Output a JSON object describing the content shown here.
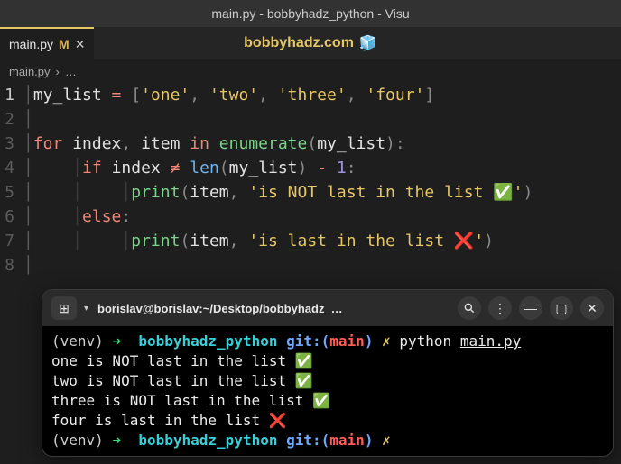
{
  "titlebar": "main.py - bobbyhadz_python - Visu",
  "tab": {
    "filename": "main.py",
    "modified_indicator": "M",
    "close_glyph": "✕"
  },
  "watermark": {
    "text": "bobbyhadz.com",
    "icon": "🧊"
  },
  "breadcrumb": {
    "file": "main.py",
    "separator": "›",
    "more": "…"
  },
  "code": {
    "lines": [
      {
        "n": "1",
        "indents": 0,
        "tokens": [
          [
            "var",
            "my_list"
          ],
          [
            "var",
            " "
          ],
          [
            "op",
            "="
          ],
          [
            "var",
            " "
          ],
          [
            "punct",
            "["
          ],
          [
            "str",
            "'one'"
          ],
          [
            "punct",
            ","
          ],
          [
            "var",
            " "
          ],
          [
            "str",
            "'two'"
          ],
          [
            "punct",
            ","
          ],
          [
            "var",
            " "
          ],
          [
            "str",
            "'three'"
          ],
          [
            "punct",
            ","
          ],
          [
            "var",
            " "
          ],
          [
            "str",
            "'four'"
          ],
          [
            "punct",
            "]"
          ]
        ]
      },
      {
        "n": "2",
        "indents": 0,
        "tokens": []
      },
      {
        "n": "3",
        "indents": 0,
        "tokens": [
          [
            "kw",
            "for"
          ],
          [
            "var",
            " index"
          ],
          [
            "punct",
            ","
          ],
          [
            "var",
            " item "
          ],
          [
            "kw",
            "in"
          ],
          [
            "var",
            " "
          ],
          [
            "call underline",
            "enumerate"
          ],
          [
            "punct",
            "("
          ],
          [
            "var",
            "my_list"
          ],
          [
            "punct",
            ")"
          ],
          [
            "punct",
            ":"
          ]
        ]
      },
      {
        "n": "4",
        "indents": 1,
        "tokens": [
          [
            "kw",
            "if"
          ],
          [
            "var",
            " index "
          ],
          [
            "op",
            "≠"
          ],
          [
            "var",
            " "
          ],
          [
            "callblue",
            "len"
          ],
          [
            "punct",
            "("
          ],
          [
            "var",
            "my_list"
          ],
          [
            "punct",
            ")"
          ],
          [
            "var",
            " "
          ],
          [
            "op",
            "-"
          ],
          [
            "var",
            " "
          ],
          [
            "num",
            "1"
          ],
          [
            "punct",
            ":"
          ]
        ]
      },
      {
        "n": "5",
        "indents": 2,
        "tokens": [
          [
            "call",
            "print"
          ],
          [
            "punct",
            "("
          ],
          [
            "var",
            "item"
          ],
          [
            "punct",
            ","
          ],
          [
            "var",
            " "
          ],
          [
            "str",
            "'is NOT last in the list ✅'"
          ],
          [
            "punct",
            ")"
          ]
        ]
      },
      {
        "n": "6",
        "indents": 1,
        "tokens": [
          [
            "kw",
            "else"
          ],
          [
            "punct",
            ":"
          ]
        ]
      },
      {
        "n": "7",
        "indents": 2,
        "tokens": [
          [
            "call",
            "print"
          ],
          [
            "punct",
            "("
          ],
          [
            "var",
            "item"
          ],
          [
            "punct",
            ","
          ],
          [
            "var",
            " "
          ],
          [
            "str",
            "'is last in the list ❌'"
          ],
          [
            "punct",
            ")"
          ]
        ]
      },
      {
        "n": "8",
        "indents": 0,
        "tokens": []
      }
    ]
  },
  "terminal": {
    "title": "borislav@borislav:~/Desktop/bobbyhadz_…",
    "prompt": {
      "venv": "(venv)",
      "arrow": "➜",
      "dir": "bobbyhadz_python",
      "git_label": "git:",
      "branch": "main",
      "lightning": "✗"
    },
    "command": {
      "exec": "python",
      "file": "main.py"
    },
    "output": [
      {
        "text": "one is NOT last in the list ",
        "mark": "✅"
      },
      {
        "text": "two is NOT last in the list ",
        "mark": "✅"
      },
      {
        "text": "three is NOT last in the list ",
        "mark": "✅"
      },
      {
        "text": "four is last in the list ",
        "mark": "❌"
      }
    ],
    "icons": {
      "newtab": "⊞",
      "search": "🔍",
      "menu": "⋮",
      "min": "—",
      "max": "▢",
      "close": "✕",
      "chevron": "▾"
    }
  }
}
